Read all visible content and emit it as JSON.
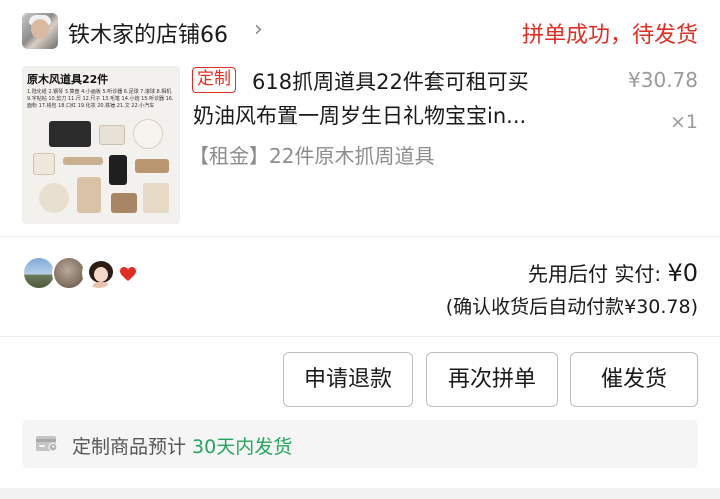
{
  "shop": {
    "name": "铁木家的店铺66",
    "chevron": "›",
    "status": "拼单成功，待发货"
  },
  "product": {
    "tag": "定制",
    "title_line1": "618抓周道具22件套可租可买",
    "title_line2": "奶油风布置一周岁生日礼物宝宝in...",
    "spec": "【租金】22件原木抓周道具",
    "price": "¥30.78",
    "quantity": "×1",
    "thumbnail": {
      "title": "原木风道具22件",
      "list_text": "1.陆化纸 2.钢琴 3.算盘 4.小画板 5.听诊器 6.足球 7.滚球 8.相机 9.字帖帖 10.剪刀 11.尺 12.尺子 13.毛笔 14.小炮 15.听诊器 16.面粉 17.钱包 18.口红 19.化妆 20.铁锤 21.文 22.小汽车"
    }
  },
  "group": {
    "avatars": [
      "sky-landscape",
      "blurred-portrait",
      "cartoon-girl"
    ],
    "heart_color": "#e02e24",
    "pay_label": "先用后付  实付: ",
    "pay_amount": "¥0",
    "auto_pay_note": "(确认收货后自动付款¥30.78)"
  },
  "actions": {
    "refund": "申请退款",
    "regroup": "再次拼单",
    "urge": "催发货"
  },
  "notice": {
    "prefix": "定制商品预计 ",
    "highlight": "30天内发货"
  },
  "colors": {
    "accent_red": "#e02e24",
    "highlight_green": "#26a65b"
  }
}
